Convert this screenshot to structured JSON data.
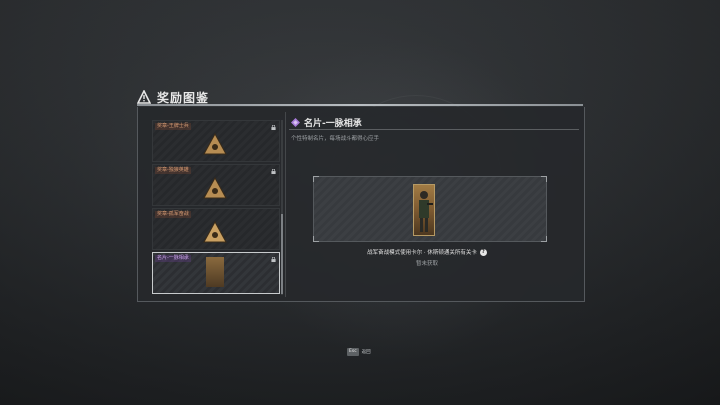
{
  "header": {
    "title": "奖励图鉴"
  },
  "rewards": [
    {
      "tag": "奖章-王牌士兵",
      "locked": true,
      "type": "medal"
    },
    {
      "tag": "奖章-独狼英雄",
      "locked": true,
      "type": "medal"
    },
    {
      "tag": "奖章-孤军奋战",
      "locked": false,
      "type": "medal"
    },
    {
      "tag": "名片-一脉相承",
      "locked": true,
      "type": "card"
    }
  ],
  "detail": {
    "title": "名片-一脉相承",
    "description": "个性特制名片，每场战斗都得心应手",
    "condition": "战军奋战模式使用卡尔 · 休斯顿通关所有关卡",
    "status": "暂未获取"
  },
  "footer": {
    "key": "Esc",
    "label": "返回"
  },
  "colors": {
    "accent_tag": "#d49a73",
    "selected_tag": "#c9a2e8",
    "gem": "#a77bd8"
  }
}
